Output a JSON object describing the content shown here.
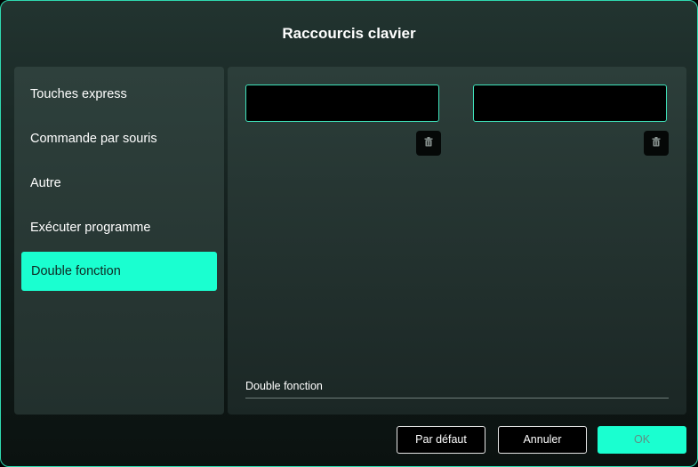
{
  "dialog": {
    "title": "Raccourcis clavier"
  },
  "sidebar": {
    "items": [
      {
        "label": "Touches express"
      },
      {
        "label": "Commande par souris"
      },
      {
        "label": "Autre"
      },
      {
        "label": "Exécuter programme"
      },
      {
        "label": "Double fonction",
        "active": true
      }
    ]
  },
  "content": {
    "key_boxes": [
      {
        "value": ""
      },
      {
        "value": ""
      }
    ],
    "trash_icon": "trash-icon",
    "field_label": "Double fonction"
  },
  "buttons": {
    "default_label": "Par défaut",
    "cancel_label": "Annuler",
    "ok_label": "OK"
  },
  "colors": {
    "accent": "#1affd0",
    "border": "#2fd9b0",
    "background": "#121d1b"
  }
}
